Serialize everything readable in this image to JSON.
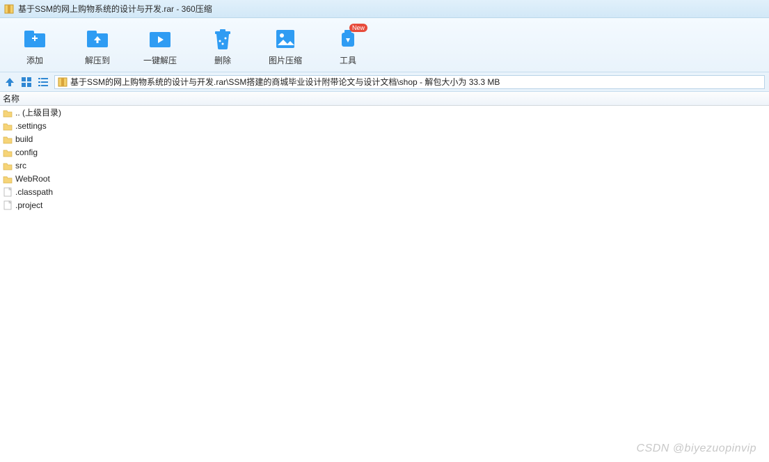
{
  "titlebar": {
    "title": "基于SSM的网上购物系统的设计与开发.rar - 360压缩"
  },
  "toolbar": {
    "add": "添加",
    "extract_to": "解压到",
    "one_click_extract": "一键解压",
    "delete": "删除",
    "image_compress": "图片压缩",
    "tools": "工具",
    "new_badge": "New"
  },
  "navbar": {
    "path": "基于SSM的网上购物系统的设计与开发.rar\\SSM搭建的商城毕业设计附带论文与设计文档\\shop - 解包大小为 33.3 MB"
  },
  "columns": {
    "name": "名称"
  },
  "files": [
    {
      "name": ".. (上级目录)",
      "type": "folder"
    },
    {
      "name": ".settings",
      "type": "folder"
    },
    {
      "name": "build",
      "type": "folder"
    },
    {
      "name": "config",
      "type": "folder"
    },
    {
      "name": "src",
      "type": "folder"
    },
    {
      "name": "WebRoot",
      "type": "folder"
    },
    {
      "name": ".classpath",
      "type": "file"
    },
    {
      "name": ".project",
      "type": "file"
    }
  ],
  "watermark": "CSDN @biyezuopinvip",
  "colors": {
    "toolbar_icon": "#2f9cf3",
    "delete_icon": "#2f9cf3",
    "folder": "#f6d478",
    "folder_stroke": "#d9b24a",
    "file_stroke": "#b0b0b0",
    "nav_icon": "#2f87d3"
  }
}
